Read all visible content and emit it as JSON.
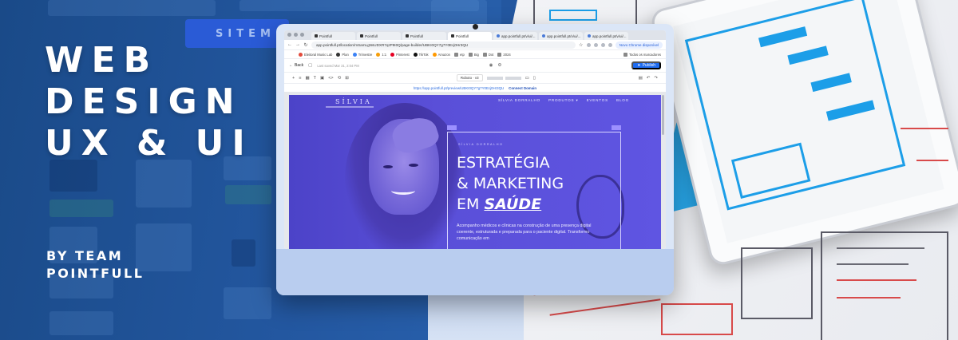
{
  "headline": {
    "line1": "WEB",
    "line2": "DESIGN",
    "line3": "UX & UI"
  },
  "byline": {
    "line1": "BY TEAM",
    "line2": "POINTFULL"
  },
  "background": {
    "sitemap_label": "SITEM"
  },
  "browser": {
    "tabs": [
      "Pointfull",
      "Pointfull",
      "Pointfull",
      "Pointfull",
      "app.pointfull.pt/v/ui/...",
      "app.pointfull.pt/v/ui/...",
      "app.pointfull.pt/v/ui/..."
    ],
    "url": "app.pointfull.pt/location/mSamLgNsUDXR7qzP9I0Q/page-builder/UBKI0QY7g7Y0Ecj0Hr3QU",
    "update_button": "Novo Chrome disponível",
    "bookmarks": [
      "Eleitoral Music Lab",
      "Plan",
      "Trimestre",
      "1:1",
      "Pinterest",
      "TikTok",
      "Amazon",
      "etp",
      "Big",
      "Dot",
      "2024"
    ],
    "bookmarks_right": "Todos os marcadores"
  },
  "builder": {
    "back_label": "Back",
    "last_saved": "Last saved Mar 31, 2:04 PM",
    "font_select": "Roboto · v3",
    "publish_label": "Publish",
    "preview_url": "https://app.pointfull.pt/preview/UBKI0QY7g7Y0Ecj0Hr3QU",
    "connect_domain": "Connect Domain"
  },
  "site": {
    "logo": "SÍLVIA",
    "nav": [
      "SÍLVIA DORRALHO",
      "PRODUTOS ▾",
      "EVENTOS",
      "BLOG"
    ],
    "eyebrow": "SÍLVIA DORRALHO",
    "heading_line1": "ESTRATÉGIA",
    "heading_line2": "& MARKETING",
    "heading_line3_prefix": "EM",
    "heading_line3_em": "SAÚDE",
    "paragraph": "Acompanho médicos e clínicas na construção de uma presença digital coerente, estruturada e preparada para o paciente digital. Transformo comunicação em"
  },
  "colors": {
    "accent": "#5a4fd8",
    "brand_blue": "#1f6cf0",
    "sketch_blue": "#1c9ee8"
  }
}
